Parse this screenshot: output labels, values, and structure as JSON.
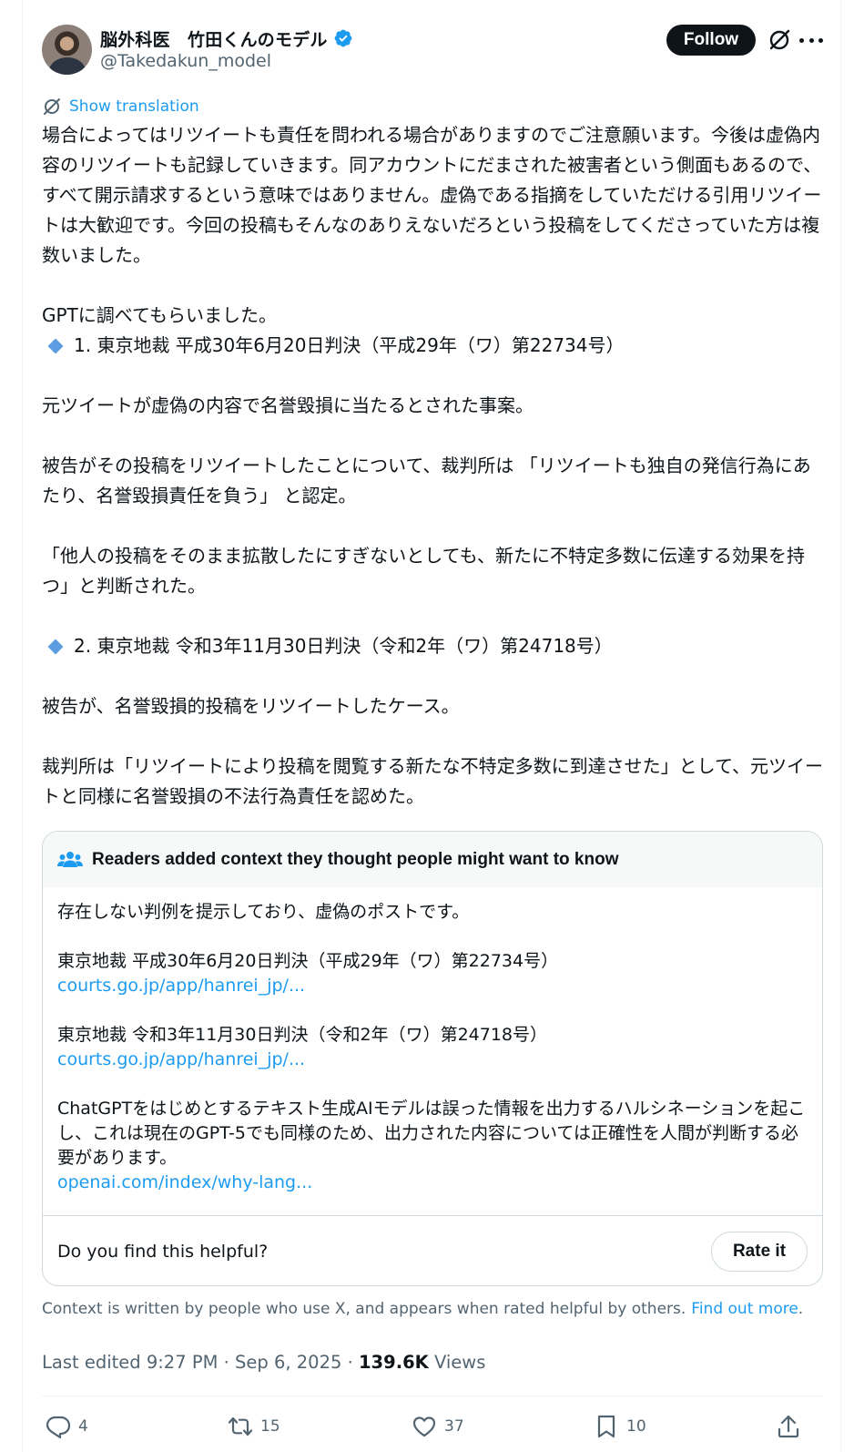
{
  "author": {
    "display_name": "脳外科医　竹田くんのモデル",
    "handle": "@Takedakun_model",
    "verified_color": "#1d9bf0"
  },
  "header": {
    "follow_label": "Follow",
    "grok_icon": "grok-icon",
    "more_icon": "more-icon"
  },
  "translate_label": "Show translation",
  "post": {
    "lines": [
      "場合によってはリツイートも責任を問われる場合がありますのでご注意願います。今後は虚偽内容のリツイートも記録していきます。同アカウントにだまされた被害者という側面もあるので、すべて開示請求するという意味ではありません。虚偽である指摘をしていただける引用リツイートは大歓迎です。今回の投稿もそんなのありえないだろという投稿をしてくださっていた方は複数いました。",
      "GPTに調べてもらいました。",
      "1. 東京地裁 平成30年6月20日判決（平成29年（ワ）第22734号）",
      "元ツイートが虚偽の内容で名誉毀損に当たるとされた事案。",
      "被告がその投稿をリツイートしたことについて、裁判所は 「リツイートも独自の発信行為にあたり、名誉毀損責任を負う」 と認定。",
      "「他人の投稿をそのまま拡散したにすぎないとしても、新たに不特定多数に伝達する効果を持つ」と判断された。",
      "2. 東京地裁 令和3年11月30日判決（令和2年（ワ）第24718号）",
      "被告が、名誉毀損的投稿をリツイートしたケース。",
      "裁判所は「リツイートにより投稿を閲覧する新たな不特定多数に到達させた」として、元ツイートと同様に名誉毀損の不法行為責任を認めた。"
    ]
  },
  "community_note": {
    "title": "Readers added context they thought people might want to know",
    "text1": "存在しない判例を提示しており、虚偽のポストです。",
    "case1": "東京地裁 平成30年6月20日判決（平成29年（ワ）第22734号）",
    "link1": "courts.go.jp/app/hanrei_jp/...",
    "case2": "東京地裁 令和3年11月30日判決（令和2年（ワ）第24718号）",
    "link2": "courts.go.jp/app/hanrei_jp/...",
    "text2": "ChatGPTをはじめとするテキスト生成AIモデルは誤った情報を出力するハルシネーションを起こし、これは現在のGPT-5でも同様のため、出力された内容については正確性を人間が判断する必要があります。",
    "link3": "openai.com/index/why-lang...",
    "helpful_question": "Do you find this helpful?",
    "rate_label": "Rate it"
  },
  "context_footer": {
    "text": "Context is written by people who use X, and appears when rated helpful by others.",
    "link": "Find out more",
    "period": "."
  },
  "meta": {
    "edited": "Last edited 9:27 PM · Sep 6, 2025 · ",
    "views_count": "139.6K",
    "views_label": " Views"
  },
  "actions": {
    "replies": "4",
    "reposts": "15",
    "likes": "37",
    "bookmarks": "10"
  }
}
